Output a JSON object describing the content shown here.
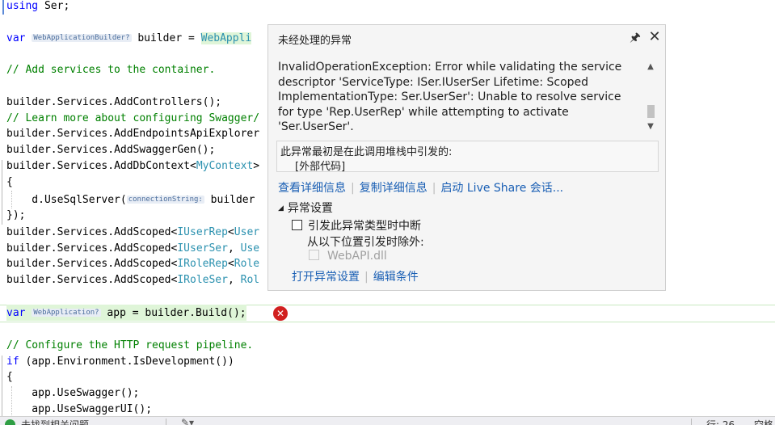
{
  "code": {
    "l1": {
      "kw": "using",
      "rest": " Ser;"
    },
    "l2": {
      "kw": "var",
      "hint": "WebApplicationBuilder?",
      "mid": " builder = ",
      "ty": "WebAppli"
    },
    "l3": "// Add services to the container.",
    "l4": {
      "pre": "builder.Services.",
      "fn": "AddControllers",
      "post": "();"
    },
    "l5": "// Learn more about configuring Swagger/",
    "l6": {
      "pre": "builder.Services.",
      "fn": "AddEndpointsApiExplorer"
    },
    "l7": {
      "pre": "builder.Services.",
      "fn": "AddSwaggerGen",
      "post": "();"
    },
    "l8": {
      "pre": "builder.Services.",
      "fn": "AddDbContext",
      "lt": "<",
      "ty": "MyContext",
      "gt": ">"
    },
    "l9": "{",
    "l10": {
      "pre": "    d.",
      "fn": "UseSqlServer",
      "open": "(",
      "hint": "connectionString:",
      "rest": " builder"
    },
    "l11": "});",
    "l12": {
      "pre": "builder.Services.",
      "fn": "AddScoped",
      "lt": "<",
      "ty": "IUserRep",
      "sep": "<",
      "ty2": "User"
    },
    "l13": {
      "pre": "builder.Services.",
      "fn": "AddScoped",
      "lt": "<",
      "ty": "IUserSer",
      "sep": ", ",
      "ty2": "Use"
    },
    "l14": {
      "pre": "builder.Services.",
      "fn": "AddScoped",
      "lt": "<",
      "ty": "IRoleRep",
      "sep": "<",
      "ty2": "Role"
    },
    "l15": {
      "pre": "builder.Services.",
      "fn": "AddScoped",
      "lt": "<",
      "ty": "IRoleSer",
      "sep": ", ",
      "ty2": "Rol"
    },
    "l16": {
      "kw": "var",
      "hint": "WebApplication?",
      "mid": " app = builder.",
      "fn": "Build",
      "post": "();"
    },
    "l17": "// Configure the HTTP request pipeline.",
    "l18": {
      "kw": "if",
      "pre": " (app.Environment.",
      "fn": "IsDevelopment",
      "post": "())"
    },
    "l19": "{",
    "l20": {
      "pre": "    app.",
      "fn": "UseSwagger",
      "post": "();"
    },
    "l21": {
      "pre": "    app.",
      "fn": "UseSwaggerUI",
      "post": "();"
    }
  },
  "popup": {
    "title": "未经处理的异常",
    "pin_glyph": "🖈",
    "close_glyph": "✕",
    "message": "InvalidOperationException: Error while validating the service descriptor 'ServiceType: ISer.IUserSer Lifetime: Scoped ImplementationType: Ser.UserSer': Unable to resolve service for type 'Rep.UserRep' while attempting to activate 'Ser.UserSer'.",
    "stack_origin": "此异常最初是在此调用堆栈中引发的:",
    "stack_frame": "[外部代码]",
    "link_details": "查看详细信息",
    "link_copy": "复制详细信息",
    "link_liveshare": "启动 Live Share 会话...",
    "settings_header": "异常设置",
    "break_label": "引发此异常类型时中断",
    "except_label": "从以下位置引发时除外:",
    "dll_label": "WebAPI.dll",
    "link_open_settings": "打开异常设置",
    "link_edit_conditions": "编辑条件"
  },
  "statusbar": {
    "text": "未找到相关问题",
    "position": "行: 26",
    "encoding": "空格"
  },
  "colors": {
    "error": "#d1201f",
    "link": "#1a5fb4",
    "keyword": "#0000ff",
    "type": "#2b91af",
    "comment": "#008000"
  }
}
